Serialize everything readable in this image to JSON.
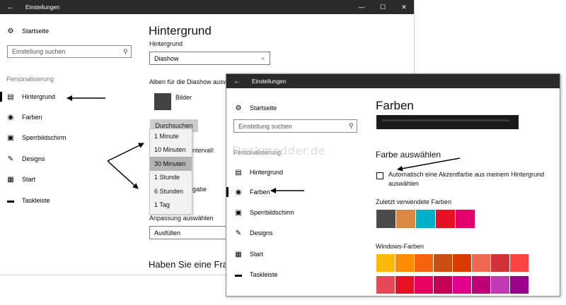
{
  "window1": {
    "title": "Einstellungen",
    "controls": {
      "minimize": "—",
      "maximize": "☐",
      "close": "✕"
    },
    "nav": {
      "home": "Startseite",
      "search_placeholder": "Einstellung suchen",
      "section": "Personalisierung",
      "items": [
        {
          "label": "Hintergrund",
          "icon": "image-icon"
        },
        {
          "label": "Farben",
          "icon": "palette-icon"
        },
        {
          "label": "Sperrbildschirm",
          "icon": "lock-screen-icon"
        },
        {
          "label": "Designs",
          "icon": "designs-icon"
        },
        {
          "label": "Start",
          "icon": "start-icon"
        },
        {
          "label": "Taskleiste",
          "icon": "taskbar-icon"
        }
      ]
    },
    "main": {
      "title": "Hintergrund",
      "background_label": "Hintergrund",
      "background_value": "Diashow",
      "albums_label": "Alben für die Diashow ausw",
      "album_name": "Bilder",
      "browse_button": "Durchsuchen",
      "interval_label_partial": "ntervall:",
      "shuffle_label_partial": "gabe",
      "fit_label": "Anpassung auswählen",
      "fit_value": "Ausfüllen",
      "question_partial": "Haben Sie eine Frage"
    },
    "interval_options": [
      "1 Minute",
      "10 Minuten",
      "30 Minuten",
      "1 Stunde",
      "6 Stunden",
      "1 Tag"
    ],
    "interval_selected": "30 Minuten"
  },
  "window2": {
    "title": "Einstellungen",
    "nav": {
      "home": "Startseite",
      "search_placeholder": "Einstellung suchen",
      "section": "Personalisierung",
      "items": [
        {
          "label": "Hintergrund",
          "icon": "image-icon"
        },
        {
          "label": "Farben",
          "icon": "palette-icon"
        },
        {
          "label": "Sperrbildschirm",
          "icon": "lock-screen-icon"
        },
        {
          "label": "Designs",
          "icon": "designs-icon"
        },
        {
          "label": "Start",
          "icon": "start-icon"
        },
        {
          "label": "Taskleiste",
          "icon": "taskbar-icon"
        }
      ]
    },
    "main": {
      "title": "Farben",
      "choose_color_heading": "Farbe auswählen",
      "auto_accent_line1": "Automatisch eine Akzentfarbe aus meinem Hintergrund",
      "auto_accent_line2": "auswählen",
      "auto_accent_checked": false,
      "recent_colors_label": "Zuletzt verwendete Farben",
      "recent_colors": [
        "#4a4a4a",
        "#d98844",
        "#00b1c9",
        "#e81123",
        "#e3006d"
      ],
      "windows_colors_label": "Windows-Farben",
      "windows_colors_row1": [
        "#ffb900",
        "#ff8c00",
        "#f7630c",
        "#ca5010",
        "#da3b01",
        "#ef6950",
        "#d13438",
        "#ff4343"
      ],
      "windows_colors_row2": [
        "#e74856",
        "#e81123",
        "#ea005e",
        "#c30052",
        "#e3008c",
        "#bf0077",
        "#c239b3",
        "#9a0089"
      ]
    }
  },
  "watermark": "Deskmodder.de",
  "colors": {
    "titlebar": "#2b2b2b",
    "dropdown_selected": "#b3b3b3",
    "button_grey": "#cccccc"
  }
}
